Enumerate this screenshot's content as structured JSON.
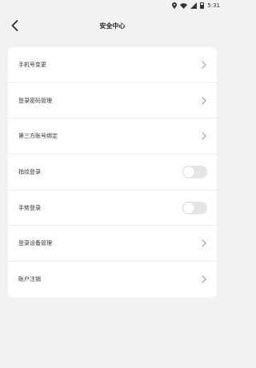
{
  "status_bar": {
    "time": "5:31",
    "icons": [
      "location-icon",
      "wifi-icon",
      "signal-icon",
      "battery-icon"
    ]
  },
  "header": {
    "title": "安全中心",
    "back_icon": "chevron-left-icon"
  },
  "settings": {
    "items": [
      {
        "label": "手机号变更",
        "type": "link"
      },
      {
        "label": "登录密码管理",
        "type": "link"
      },
      {
        "label": "第三方账号绑定",
        "type": "link"
      },
      {
        "label": "指纹登录",
        "type": "toggle",
        "on": false
      },
      {
        "label": "手势登录",
        "type": "toggle",
        "on": false
      },
      {
        "label": "登录设备管理",
        "type": "link"
      },
      {
        "label": "账户注销",
        "type": "link"
      }
    ]
  },
  "colors": {
    "background": "#f2f2f2",
    "card": "#ffffff",
    "toggle_off": "#e5e5e5"
  }
}
